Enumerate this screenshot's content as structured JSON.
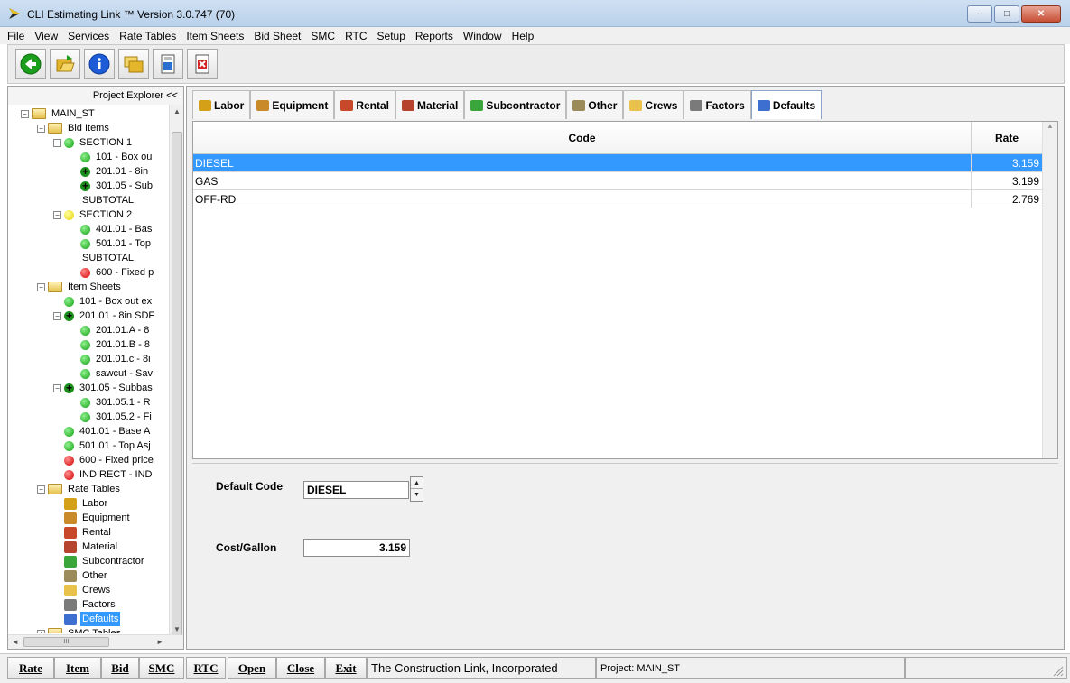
{
  "window": {
    "title": "CLI Estimating Link ™ Version  3.0.747 (70)",
    "controls": {
      "minimize": "–",
      "maximize": "□",
      "close": "✕"
    }
  },
  "menu": [
    "File",
    "View",
    "Services",
    "Rate Tables",
    "Item Sheets",
    "Bid Sheet",
    "SMC",
    "RTC",
    "Setup",
    "Reports",
    "Window",
    "Help"
  ],
  "toolbar": [
    {
      "icon": "back-arrow-icon",
      "color": "#1b9e1b"
    },
    {
      "icon": "open-folder-icon",
      "color": "#e3b52b"
    },
    {
      "icon": "info-icon",
      "color": "#1e5bd6"
    },
    {
      "icon": "folders-icon",
      "color": "#e3b52b"
    },
    {
      "icon": "save-document-icon",
      "color": "#2a6fd0"
    },
    {
      "icon": "close-document-icon",
      "color": "#d42020"
    }
  ],
  "explorer": {
    "header": "Project Explorer <<",
    "tree": [
      {
        "indent": 0,
        "expander": "−",
        "icon": "folder",
        "label": "MAIN_ST"
      },
      {
        "indent": 1,
        "expander": "−",
        "icon": "folder",
        "label": "Bid Items"
      },
      {
        "indent": 2,
        "expander": "−",
        "icon": "green",
        "label": "SECTION 1"
      },
      {
        "indent": 3,
        "expander": "",
        "icon": "green",
        "label": "101 - Box ou"
      },
      {
        "indent": 3,
        "expander": "",
        "icon": "plus",
        "label": "201.01 - 8in"
      },
      {
        "indent": 3,
        "expander": "",
        "icon": "plus",
        "label": "301.05 - Sub"
      },
      {
        "indent": 3,
        "expander": "",
        "icon": "none",
        "label": "SUBTOTAL"
      },
      {
        "indent": 2,
        "expander": "−",
        "icon": "yellow",
        "label": "SECTION 2"
      },
      {
        "indent": 3,
        "expander": "",
        "icon": "green",
        "label": "401.01 - Bas"
      },
      {
        "indent": 3,
        "expander": "",
        "icon": "green",
        "label": "501.01 - Top"
      },
      {
        "indent": 3,
        "expander": "",
        "icon": "none",
        "label": "SUBTOTAL"
      },
      {
        "indent": 3,
        "expander": "",
        "icon": "red",
        "label": "600 - Fixed p"
      },
      {
        "indent": 1,
        "expander": "−",
        "icon": "folder",
        "label": "Item Sheets"
      },
      {
        "indent": 2,
        "expander": "",
        "icon": "green",
        "label": "101 - Box out ex"
      },
      {
        "indent": 2,
        "expander": "−",
        "icon": "plus",
        "label": "201.01 - 8in SDF"
      },
      {
        "indent": 3,
        "expander": "",
        "icon": "green",
        "label": "201.01.A - 8"
      },
      {
        "indent": 3,
        "expander": "",
        "icon": "green",
        "label": "201.01.B - 8"
      },
      {
        "indent": 3,
        "expander": "",
        "icon": "green",
        "label": "201.01.c - 8i"
      },
      {
        "indent": 3,
        "expander": "",
        "icon": "green",
        "label": "sawcut - Sav"
      },
      {
        "indent": 2,
        "expander": "−",
        "icon": "plus",
        "label": "301.05 - Subbas"
      },
      {
        "indent": 3,
        "expander": "",
        "icon": "green",
        "label": "301.05.1 - R"
      },
      {
        "indent": 3,
        "expander": "",
        "icon": "green",
        "label": "301.05.2 - Fi"
      },
      {
        "indent": 2,
        "expander": "",
        "icon": "green",
        "label": "401.01 - Base A"
      },
      {
        "indent": 2,
        "expander": "",
        "icon": "green",
        "label": "501.01 - Top Asj"
      },
      {
        "indent": 2,
        "expander": "",
        "icon": "red",
        "label": "600 - Fixed price"
      },
      {
        "indent": 2,
        "expander": "",
        "icon": "red",
        "label": "INDIRECT - IND"
      },
      {
        "indent": 1,
        "expander": "−",
        "icon": "folder",
        "label": "Rate Tables"
      },
      {
        "indent": 2,
        "expander": "",
        "icon": "labor",
        "label": "Labor"
      },
      {
        "indent": 2,
        "expander": "",
        "icon": "equipment",
        "label": "Equipment"
      },
      {
        "indent": 2,
        "expander": "",
        "icon": "rental",
        "label": "Rental"
      },
      {
        "indent": 2,
        "expander": "",
        "icon": "material",
        "label": "Material"
      },
      {
        "indent": 2,
        "expander": "",
        "icon": "subcontractor",
        "label": "Subcontractor"
      },
      {
        "indent": 2,
        "expander": "",
        "icon": "other",
        "label": "Other"
      },
      {
        "indent": 2,
        "expander": "",
        "icon": "crews",
        "label": "Crews"
      },
      {
        "indent": 2,
        "expander": "",
        "icon": "factors",
        "label": "Factors"
      },
      {
        "indent": 2,
        "expander": "",
        "icon": "defaults",
        "label": "Defaults",
        "selected": true
      },
      {
        "indent": 1,
        "expander": "+",
        "icon": "folder",
        "label": "SMC Tables"
      }
    ],
    "hscroll_label": "III"
  },
  "tabs": [
    {
      "label": "Labor",
      "icon": "labor-icon",
      "color": "#d4a017"
    },
    {
      "label": "Equipment",
      "icon": "equipment-icon",
      "color": "#c98a2a"
    },
    {
      "label": "Rental",
      "icon": "rental-icon",
      "color": "#c8492a"
    },
    {
      "label": "Material",
      "icon": "material-icon",
      "color": "#b5432e"
    },
    {
      "label": "Subcontractor",
      "icon": "subcontractor-icon",
      "color": "#3aa53a"
    },
    {
      "label": "Other",
      "icon": "other-icon",
      "color": "#9b8a5a"
    },
    {
      "label": "Crews",
      "icon": "crews-icon",
      "color": "#e8c24a"
    },
    {
      "label": "Factors",
      "icon": "factors-icon",
      "color": "#7a7a7a"
    },
    {
      "label": "Defaults",
      "icon": "defaults-icon",
      "color": "#3c6fd0",
      "active": true
    }
  ],
  "grid": {
    "columns": [
      "Code",
      "Rate"
    ],
    "rows": [
      {
        "code": "DIESEL",
        "rate": "3.159",
        "selected": true
      },
      {
        "code": "GAS",
        "rate": "3.199"
      },
      {
        "code": "OFF-RD",
        "rate": "2.769"
      }
    ]
  },
  "form": {
    "default_code_label": "Default Code",
    "default_code_value": "DIESEL",
    "cost_gallon_label": "Cost/Gallon",
    "cost_gallon_value": "3.159"
  },
  "statusbar": {
    "buttons": [
      "Rate",
      "Item",
      "Bid",
      "SMC",
      "RTC",
      "Open",
      "Close",
      "Exit"
    ],
    "company": "The Construction Link, Incorporated",
    "project": "Project: MAIN_ST"
  },
  "colors": {
    "selection": "#3399ff",
    "titlebar": "#cfe0f3"
  }
}
